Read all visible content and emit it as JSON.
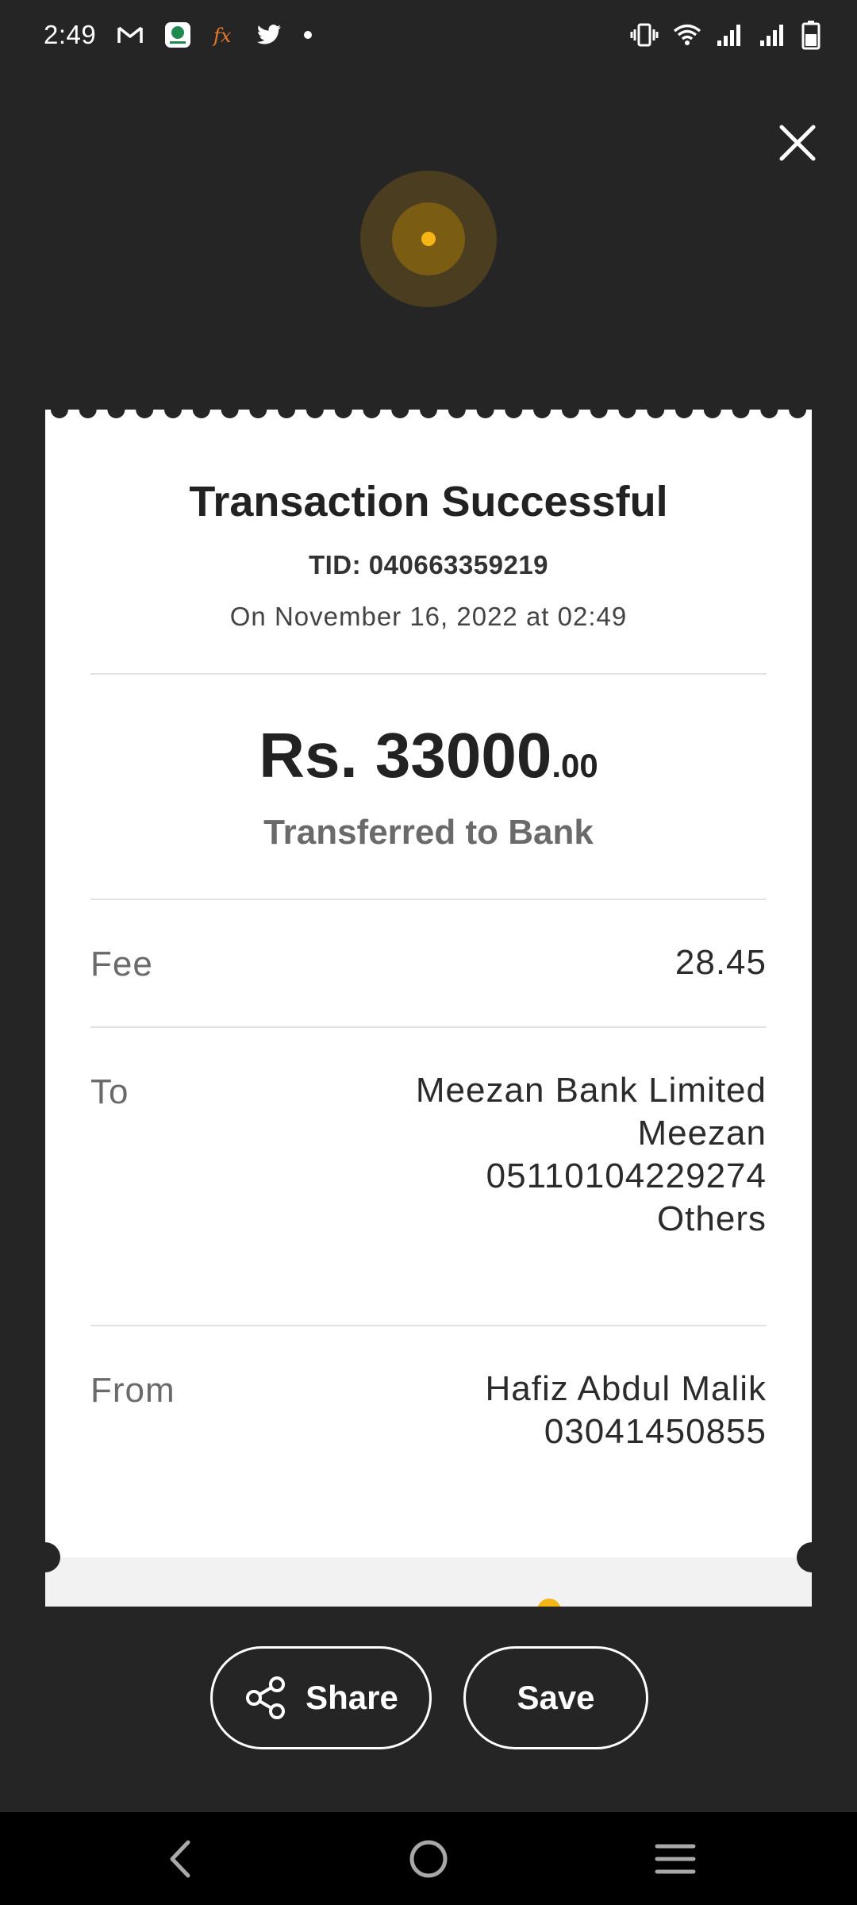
{
  "status_bar": {
    "time": "2:49",
    "notification_icons": [
      "gmail-icon",
      "app-icon",
      "fx-icon",
      "twitter-icon",
      "dot-icon"
    ],
    "system_icons": [
      "vibrate-icon",
      "wifi-icon",
      "signal-icon",
      "signal-icon",
      "battery-icon"
    ]
  },
  "receipt": {
    "title": "Transaction Successful",
    "tid": "TID: 040663359219",
    "date": "On November 16, 2022 at 02:49",
    "amount": {
      "main": "Rs. 33000",
      "decimal": ".00"
    },
    "amount_subtitle": "Transferred to Bank",
    "fee": {
      "label": "Fee",
      "value": "28.45"
    },
    "to": {
      "label": "To",
      "lines": [
        "Meezan Bank Limited",
        "Meezan",
        "05110104229274",
        "Others"
      ]
    },
    "from": {
      "label": "From",
      "lines": [
        "Hafiz Abdul Malik",
        "03041450855"
      ]
    }
  },
  "actions": {
    "share_label": "Share",
    "save_label": "Save"
  },
  "colors": {
    "background": "#252525",
    "accent": "#f5b514",
    "card": "#ffffff"
  }
}
